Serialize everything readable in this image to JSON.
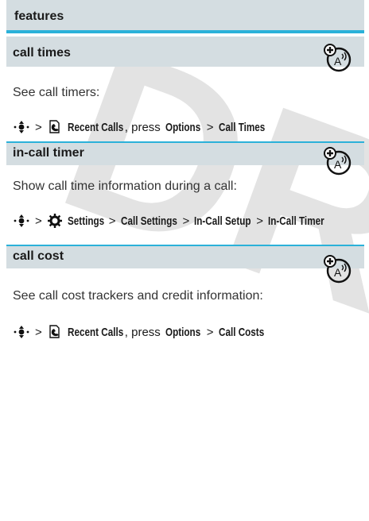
{
  "header": {
    "title": "features"
  },
  "watermark": "DRAFT",
  "sections": [
    {
      "title": "call times",
      "description": "See call timers:",
      "path": {
        "greater": ">",
        "menu_label": "Recent Calls",
        "comma_press": ", press",
        "options": "Options",
        "greater2": ">",
        "target": "Call Times"
      }
    },
    {
      "title": "in-call timer",
      "description": "Show call time information during a call:",
      "path": {
        "greater": ">",
        "menu_label": "Settings",
        "greater2": ">",
        "step2": "Call Settings",
        "greater3": ">",
        "step3": "In-Call Setup",
        "greater4": ">",
        "target": "In-Call Timer"
      }
    },
    {
      "title": "call cost",
      "description": "See call cost trackers and credit information:",
      "path": {
        "greater": ">",
        "menu_label": "Recent Calls",
        "comma_press": ", press",
        "options": "Options",
        "greater2": ">",
        "target": "Call Costs"
      }
    }
  ],
  "icons": {
    "nav": "navigation-key-icon",
    "recent_calls": "recent-calls-icon",
    "settings": "settings-gear-icon",
    "feature_badge": "network-feature-icon"
  },
  "colors": {
    "accent": "#2bb1d9",
    "header_bg": "#d4dde1"
  }
}
